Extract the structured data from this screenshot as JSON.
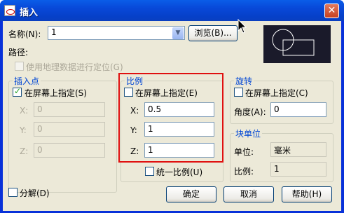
{
  "title": "插入",
  "name_label": "名称(N):",
  "name_value": "1",
  "browse_label": "浏览(B)...",
  "path_label": "路径:",
  "geo_label": "使用地理数据进行定位(G)",
  "insert_point": {
    "title": "插入点",
    "onscreen": "在屏幕上指定(S)",
    "x_label": "X:",
    "x_value": "0",
    "y_label": "Y:",
    "y_value": "0",
    "z_label": "Z:",
    "z_value": "0"
  },
  "scale": {
    "title": "比例",
    "onscreen": "在屏幕上指定(E)",
    "x_label": "X:",
    "x_value": "0.5",
    "y_label": "Y:",
    "y_value": "1",
    "z_label": "Z:",
    "z_value": "1",
    "uniform": "统一比例(U)"
  },
  "rotation": {
    "title": "旋转",
    "onscreen": "在屏幕上指定(C)",
    "angle_label": "角度(A):",
    "angle_value": "0"
  },
  "block_unit": {
    "title": "块单位",
    "unit_label": "单位:",
    "unit_value": "毫米",
    "factor_label": "比例:",
    "factor_value": "1"
  },
  "explode_label": "分解(D)",
  "ok_label": "确定",
  "cancel_label": "取消",
  "help_label": "帮助(H)",
  "colors": {
    "title_bar": "#0a5de8",
    "highlight": "#e01010",
    "group_title": "#0046d5"
  }
}
